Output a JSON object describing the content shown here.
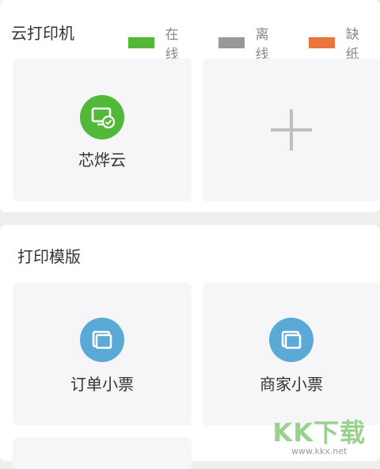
{
  "printers_section": {
    "title": "云打印机",
    "legend": [
      {
        "label": "在线",
        "color": "#52b83a"
      },
      {
        "label": "离线",
        "color": "#999999"
      },
      {
        "label": "缺纸",
        "color": "#e8763a"
      }
    ],
    "printers": [
      {
        "name": "芯烨云",
        "icon": "printer-online-icon",
        "color": "#52b83a"
      }
    ],
    "add_icon": "plus-icon"
  },
  "templates_section": {
    "title": "打印模版",
    "templates": [
      {
        "name": "订单小票",
        "icon": "template-icon",
        "color": "#5aa9d6"
      },
      {
        "name": "商家小票",
        "icon": "template-icon",
        "color": "#5aa9d6"
      }
    ]
  },
  "watermark": {
    "logo": "KK下载",
    "url": "www.kkx.net"
  }
}
